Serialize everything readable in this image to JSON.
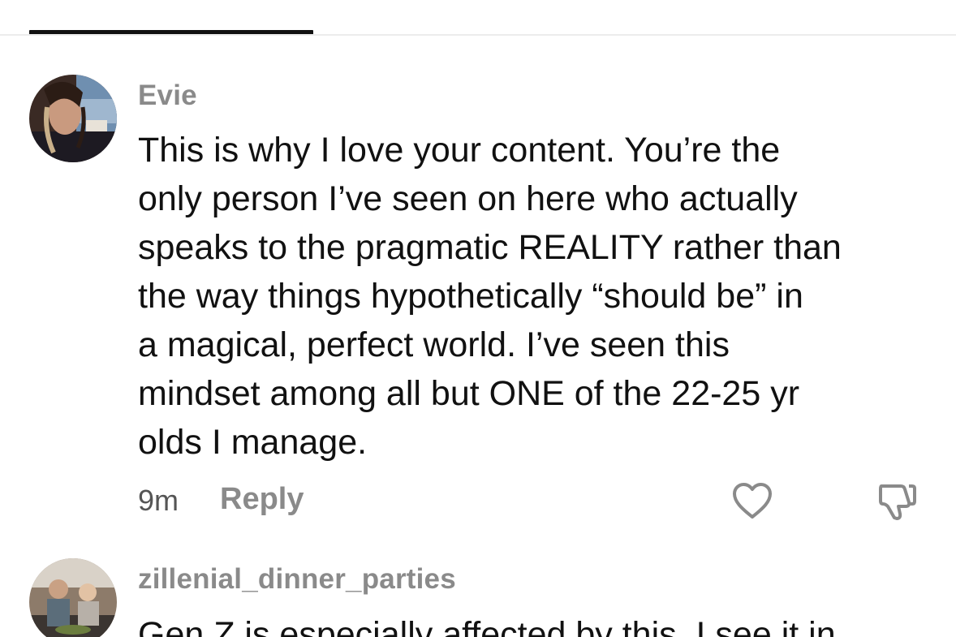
{
  "comments": [
    {
      "username": "Evie",
      "text_lines": [
        "This is why I love your content. You’re the",
        "only person I’ve seen on here who actually",
        "speaks to the pragmatic REALITY rather than",
        "the way things hypothetically “should be” in",
        "a magical, perfect world. I’ve seen this",
        "mindset among all but ONE of the 22-25 yr",
        "olds I manage."
      ],
      "time": "9m",
      "reply_label": "Reply",
      "like_icon": "heart-outline-icon",
      "dislike_icon": "thumbs-down-icon"
    },
    {
      "username": "zillenial_dinner_parties",
      "text_lines": [
        "Gen Z is especially affected by this. I see it in"
      ]
    }
  ]
}
